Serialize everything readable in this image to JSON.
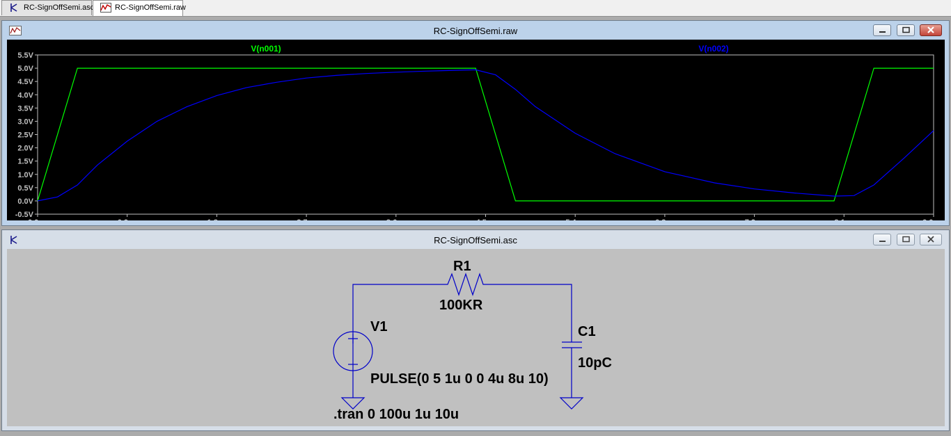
{
  "tabs": [
    {
      "label": "RC-SignOffSemi.asc",
      "icon": "schematic-icon"
    },
    {
      "label": "RC-SignOffSemi.raw",
      "icon": "waveform-icon"
    }
  ],
  "waveform_window": {
    "title": "RC-SignOffSemi.raw",
    "icon": "waveform-icon",
    "buttons": [
      "minimize",
      "restore",
      "close"
    ]
  },
  "schematic_window": {
    "title": "RC-SignOffSemi.asc",
    "icon": "schematic-icon",
    "buttons": [
      "minimize",
      "restore",
      "close"
    ]
  },
  "chart_data": {
    "type": "line",
    "background": "#000000",
    "axis_color": "#c0c0c0",
    "x_ticks": [
      "0.0µs",
      "0.9µs",
      "1.8µs",
      "2.7µs",
      "3.6µs",
      "4.5µs",
      "5.4µs",
      "6.3µs",
      "7.2µs",
      "8.1µs",
      "9.0µs"
    ],
    "y_ticks": [
      "5.5V",
      "5.0V",
      "4.5V",
      "4.0V",
      "3.5V",
      "3.0V",
      "2.5V",
      "2.0V",
      "1.5V",
      "1.0V",
      "0.5V",
      "0.0V",
      "-0.5V"
    ],
    "xlim": [
      0,
      9
    ],
    "ylim": [
      -0.5,
      5.5
    ],
    "x_unit": "µs",
    "y_unit": "V",
    "series": [
      {
        "name": "V(n001)",
        "color": "#00ff00",
        "x": [
          0,
          0.4,
          4.4,
          4.8,
          8.0,
          8.4,
          9.0
        ],
        "y": [
          0,
          5,
          5,
          0,
          0,
          5,
          5
        ]
      },
      {
        "name": "V(n002)",
        "color": "#0000ff",
        "x": [
          0,
          0.2,
          0.4,
          0.6,
          0.9,
          1.2,
          1.5,
          1.8,
          2.1,
          2.4,
          2.7,
          3.0,
          3.3,
          3.6,
          3.9,
          4.2,
          4.4,
          4.6,
          4.8,
          5.0,
          5.4,
          5.8,
          6.3,
          6.8,
          7.2,
          7.6,
          8.0,
          8.2,
          8.4,
          8.7,
          9.0
        ],
        "y": [
          0,
          0.15,
          0.6,
          1.35,
          2.25,
          3.0,
          3.55,
          3.97,
          4.27,
          4.47,
          4.63,
          4.73,
          4.8,
          4.85,
          4.89,
          4.92,
          4.94,
          4.75,
          4.2,
          3.55,
          2.55,
          1.78,
          1.1,
          0.68,
          0.45,
          0.3,
          0.18,
          0.2,
          0.6,
          1.6,
          2.65
        ]
      }
    ]
  },
  "schematic": {
    "wire_color": "#0000c8",
    "components": [
      {
        "ref": "R1",
        "value": "100KR",
        "type": "resistor"
      },
      {
        "ref": "C1",
        "value": "10pC",
        "type": "capacitor"
      },
      {
        "ref": "V1",
        "value": "PULSE(0 5 1u 0 0 4u 8u 10)",
        "type": "voltage-source"
      }
    ],
    "directive": ".tran 0 100u 1u 10u"
  }
}
